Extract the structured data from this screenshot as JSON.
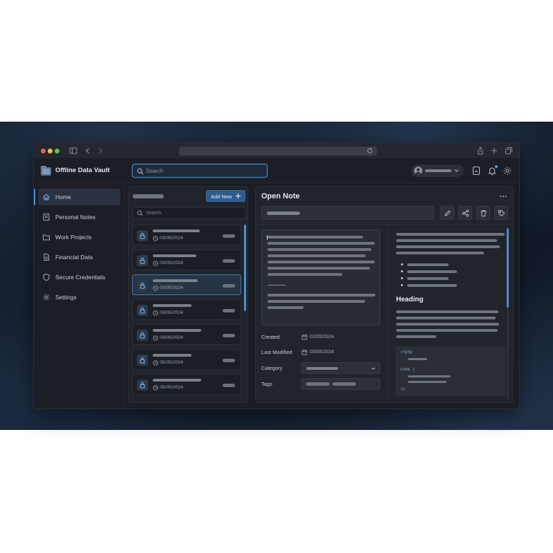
{
  "app": {
    "title": "Offline Data Vault"
  },
  "header": {
    "search_placeholder": "Search"
  },
  "sidebar": {
    "items": [
      {
        "label": "Home",
        "icon": "home-icon",
        "active": true
      },
      {
        "label": "Personal Notes",
        "icon": "note-icon",
        "active": false
      },
      {
        "label": "Work Projects",
        "icon": "folder-icon",
        "active": false
      },
      {
        "label": "Financial Data",
        "icon": "document-icon",
        "active": false
      },
      {
        "label": "Secure Credentials",
        "icon": "shield-icon",
        "active": false
      },
      {
        "label": "Settings",
        "icon": "gear-icon",
        "active": false
      }
    ]
  },
  "list": {
    "add_label": "Add New",
    "search_placeholder": "Search",
    "notes": [
      {
        "date": "03/05/2024",
        "selected": false
      },
      {
        "date": "03/05/2024",
        "selected": false
      },
      {
        "date": "03/05/2024",
        "selected": true
      },
      {
        "date": "03/05/2024",
        "selected": false
      },
      {
        "date": "03/05/2024",
        "selected": false
      },
      {
        "date": "05/05/2024",
        "selected": false
      },
      {
        "date": "05/05/2024",
        "selected": false
      }
    ]
  },
  "note": {
    "heading": "Open Note",
    "created_label": "Created",
    "created_value": "02/05/2024",
    "modified_label": "Last Modified",
    "modified_value": "03/05/2024",
    "category_label": "Category",
    "tags_label": "Tags"
  },
  "preview": {
    "heading": "Heading",
    "code_open": "<?php",
    "code_keyword": "code {",
    "code_close": "?>"
  },
  "colors": {
    "accent": "#4d8fd4",
    "button": "#2f5c8e",
    "background": "#1a1d23"
  }
}
